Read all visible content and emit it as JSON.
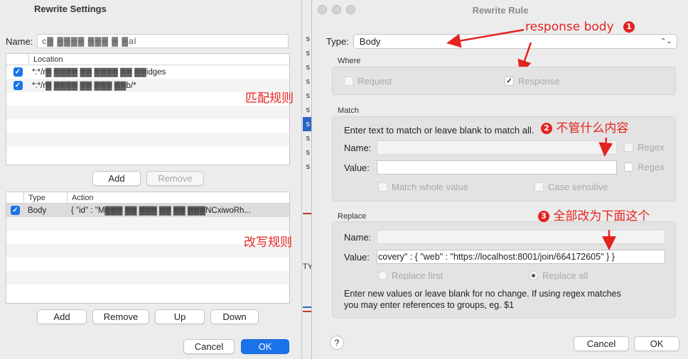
{
  "left_dialog": {
    "title": "Rewrite Settings",
    "name_label": "Name:",
    "name_value": "c▓ ▓▓▓▓  ▓▓▓ ▓ ▓al",
    "location_table": {
      "header": "Location",
      "rows": [
        {
          "checked": true,
          "text": "*:*/r▓ ▓▓▓▓ ▓▓ ▓▓▓▓ ▓▓ ▓▓idges"
        },
        {
          "checked": true,
          "text": "*:*/r▓ ▓▓▓▓ ▓▓ ▓▓▓ ▓▓b/*"
        }
      ]
    },
    "location_buttons": {
      "add": "Add",
      "remove": "Remove"
    },
    "annotation_match": "匹配规则",
    "rules_table": {
      "headers": [
        "Type",
        "Action"
      ],
      "rows": [
        {
          "checked": true,
          "type": "Body",
          "action": "{  \"id\" : \"M▓▓▓ ▓▓ ▓▓▓ ▓▓ ▓▓ ▓▓▓NCxiwoRh..."
        }
      ]
    },
    "annotation_rewrite": "改写规则",
    "rule_buttons": {
      "add": "Add",
      "remove": "Remove",
      "up": "Up",
      "down": "Down"
    },
    "footer": {
      "cancel": "Cancel",
      "ok": "OK"
    }
  },
  "strip_cells": [
    "s",
    "s",
    "s",
    "s",
    "s",
    "s",
    "s",
    "s",
    "s",
    "s",
    "s"
  ],
  "strip_fragment": "TY",
  "right_dialog": {
    "title": "Rewrite Rule",
    "type_label": "Type:",
    "type_value": "Body",
    "annotation_1": "response body",
    "badge_1": "1",
    "where": {
      "title": "Where",
      "request": "Request",
      "response": "Response",
      "request_checked": false,
      "response_checked": true
    },
    "match": {
      "title": "Match",
      "hint": "Enter text to match or leave blank to match all.",
      "name_label": "Name:",
      "value_label": "Value:",
      "regex": "Regex",
      "match_whole": "Match whole value",
      "case_sensitive": "Case sensitive"
    },
    "annotation_2": "不管什么内容",
    "badge_2": "2",
    "replace": {
      "title": "Replace",
      "name_label": "Name:",
      "value_label": "Value:",
      "value": "covery\" : {      \"web\" : \"https://localhost:8001/join/664172605\"   } }",
      "replace_first": "Replace first",
      "replace_all": "Replace all",
      "hint_line1": "Enter new values or leave blank for no change. If using regex matches",
      "hint_line2": "you may enter references to groups, eg. $1"
    },
    "annotation_3": "全部改为下面这个",
    "badge_3": "3",
    "help": "?",
    "footer": {
      "cancel": "Cancel",
      "ok": "OK"
    }
  },
  "colors": {
    "accent": "#1a73e8",
    "annotation": "#e4231f"
  }
}
